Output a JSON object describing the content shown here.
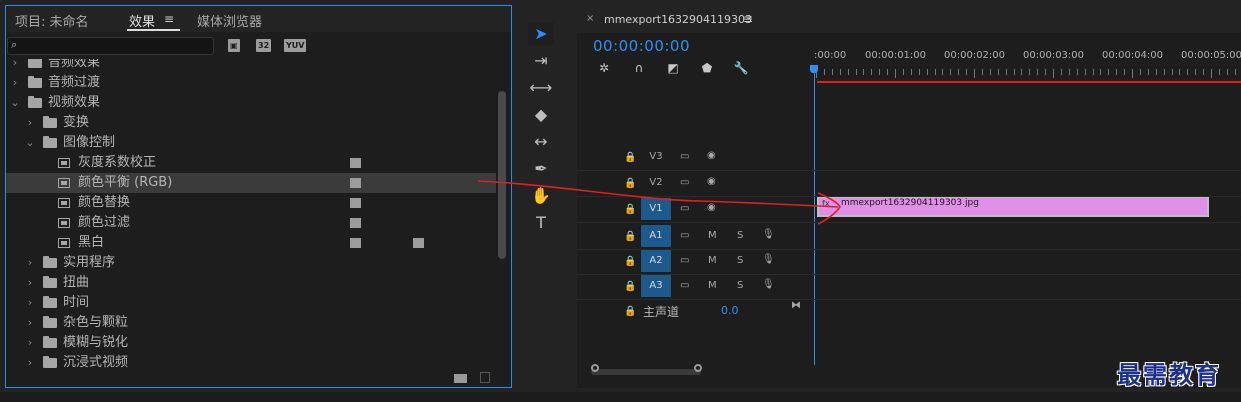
{
  "effects_panel": {
    "tabs": [
      {
        "label": "项目: 未命名"
      },
      {
        "label": "效果"
      },
      {
        "label": "媒体浏览器"
      }
    ],
    "menu_icon": "≡",
    "search": {
      "value": "",
      "placeholder": ""
    },
    "filter_badges": [
      "32",
      "YUV"
    ],
    "tree": [
      {
        "type": "folder",
        "label": "音频效果",
        "indent": 0,
        "expanded": false
      },
      {
        "type": "folder",
        "label": "音频过渡",
        "indent": 0,
        "expanded": false
      },
      {
        "type": "folder",
        "label": "视频效果",
        "indent": 0,
        "expanded": true
      },
      {
        "type": "folder",
        "label": "变换",
        "indent": 1,
        "expanded": false
      },
      {
        "type": "folder",
        "label": "图像控制",
        "indent": 1,
        "expanded": true
      },
      {
        "type": "effect",
        "label": "灰度系数校正",
        "indent": 2,
        "accelerated": true,
        "yuv": false
      },
      {
        "type": "effect",
        "label": "颜色平衡 (RGB)",
        "indent": 2,
        "accelerated": true,
        "yuv": false,
        "selected": true
      },
      {
        "type": "effect",
        "label": "颜色替换",
        "indent": 2,
        "accelerated": true,
        "yuv": false
      },
      {
        "type": "effect",
        "label": "颜色过滤",
        "indent": 2,
        "accelerated": true,
        "yuv": false
      },
      {
        "type": "effect",
        "label": "黑白",
        "indent": 2,
        "accelerated": true,
        "yuv": true
      },
      {
        "type": "folder",
        "label": "实用程序",
        "indent": 1,
        "expanded": false
      },
      {
        "type": "folder",
        "label": "扭曲",
        "indent": 1,
        "expanded": false
      },
      {
        "type": "folder",
        "label": "时间",
        "indent": 1,
        "expanded": false
      },
      {
        "type": "folder",
        "label": "杂色与颗粒",
        "indent": 1,
        "expanded": false
      },
      {
        "type": "folder",
        "label": "模糊与锐化",
        "indent": 1,
        "expanded": false
      },
      {
        "type": "folder",
        "label": "沉浸式视频",
        "indent": 1,
        "expanded": false
      }
    ]
  },
  "tools": [
    {
      "name": "selection-tool-icon",
      "glyph": "➤",
      "active": true
    },
    {
      "name": "track-select-tool-icon",
      "glyph": "⇥"
    },
    {
      "name": "ripple-edit-tool-icon",
      "glyph": "⟷"
    },
    {
      "name": "razor-tool-icon",
      "glyph": "◆"
    },
    {
      "name": "slip-tool-icon",
      "glyph": "↔"
    },
    {
      "name": "pen-tool-icon",
      "glyph": "✒"
    },
    {
      "name": "hand-tool-icon",
      "glyph": "✋"
    },
    {
      "name": "type-tool-icon",
      "glyph": "T"
    }
  ],
  "timeline": {
    "sequence_tab": "mmexport1632904119303",
    "close_glyph": "×",
    "menu_icon": "≡",
    "timecode": "00:00:00:00",
    "ruler_labels": [
      ":00:00",
      "00:00:01:00",
      "00:00:02:00",
      "00:00:03:00",
      "00:00:04:00",
      "00:00:05:00"
    ],
    "video_tracks": [
      {
        "name": "V3",
        "target": false
      },
      {
        "name": "V2",
        "target": false
      },
      {
        "name": "V1",
        "target": true
      }
    ],
    "audio_tracks": [
      {
        "name": "A1",
        "mute": "M",
        "solo": "S"
      },
      {
        "name": "A2",
        "mute": "M",
        "solo": "S"
      },
      {
        "name": "A3",
        "mute": "M",
        "solo": "S"
      }
    ],
    "master": {
      "label": "主声道",
      "value": "0.0"
    },
    "clip": {
      "label": "mmexport1632904119303.jpg",
      "fx": "fx"
    },
    "accent_color": "#2f8ff0",
    "clip_color": "#e08ee8"
  },
  "watermark": "最需教育"
}
